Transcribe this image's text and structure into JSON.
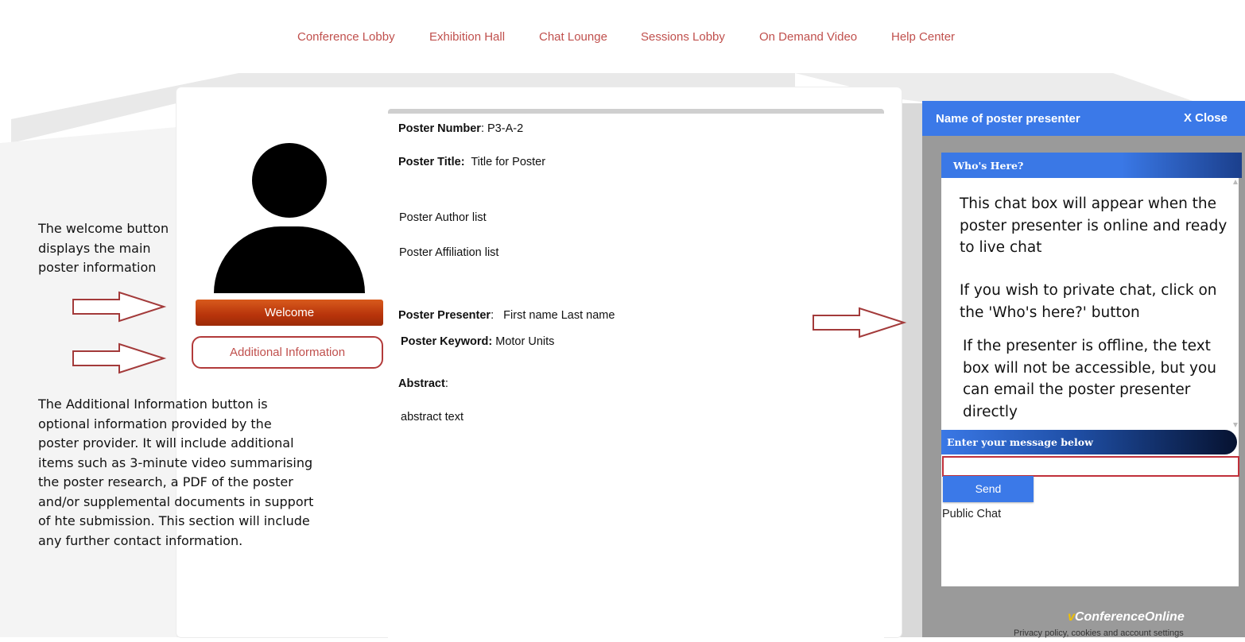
{
  "nav": {
    "items": [
      "Conference Lobby",
      "Exhibition Hall",
      "Chat Lounge",
      "Sessions Lobby",
      "On Demand Video",
      "Help Center"
    ]
  },
  "poster": {
    "welcome_label": "Welcome",
    "additional_label": "Additional Information",
    "number_label": "Poster Number",
    "number_value": ": P3-A-2",
    "title_label": "Poster Title:",
    "title_value": "Title for Poster",
    "author_list": "Poster Author list",
    "affiliation_list": "Poster Affiliation list",
    "presenter_label": "Poster Presenter",
    "presenter_value": ":   First name Last name",
    "keyword_label": "Poster Keyword:",
    "keyword_value": "Motor Units",
    "abstract_label": "Abstract",
    "abstract_colon": ":",
    "abstract_text": "abstract text"
  },
  "annotations": {
    "welcome_note": [
      "The welcome button",
      "displays the main",
      "poster information"
    ],
    "additional_note": [
      "The Additional Information button is",
      "optional information provided by the",
      "poster provider.  It will include additional",
      "items such as 3-minute video summarising",
      "the poster research, a PDF of the poster",
      "and/or supplemental documents in support",
      "of hte submission.  This section will include",
      "any further contact information."
    ]
  },
  "chat": {
    "header_title": "Name of poster presenter",
    "close_label": "X Close",
    "whos_here": "Who's Here?",
    "message_1": [
      "This chat box will appear when the",
      "poster presenter is online and ready",
      "to live chat"
    ],
    "message_2": [
      "If you wish to private chat, click on",
      "the 'Who's here?' button"
    ],
    "message_3": [
      "If the presenter is offline, the text",
      "box will not be accessible, but you",
      "can email the poster presenter",
      "directly"
    ],
    "enter_message": "Enter your message below",
    "input_value": "",
    "send_label": "Send",
    "public_chat": "Public Chat",
    "brand_prefix": "v",
    "brand_name": "ConferenceOnline",
    "footer_link": "Privacy policy, cookies and account settings"
  },
  "colors": {
    "nav_link": "#c0504d",
    "welcome_button": "#c2410f",
    "chat_header": "#3b79e8",
    "annotation_arrow": "#a33a3a"
  }
}
